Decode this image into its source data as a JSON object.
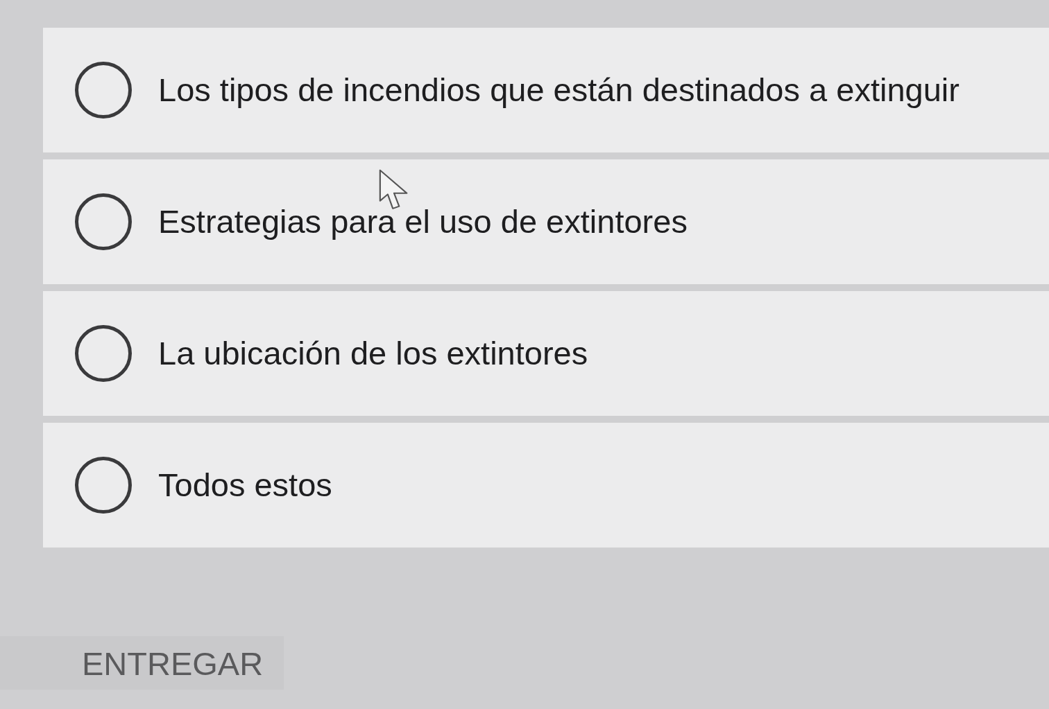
{
  "options": [
    {
      "label": "Los tipos de incendios que están destinados a extinguir",
      "selected": false
    },
    {
      "label": "Estrategias para el uso de extintores",
      "selected": false
    },
    {
      "label": "La ubicación de los extintores",
      "selected": false
    },
    {
      "label": "Todos estos",
      "selected": false
    }
  ],
  "submit_button": {
    "label": "ENTREGAR"
  }
}
